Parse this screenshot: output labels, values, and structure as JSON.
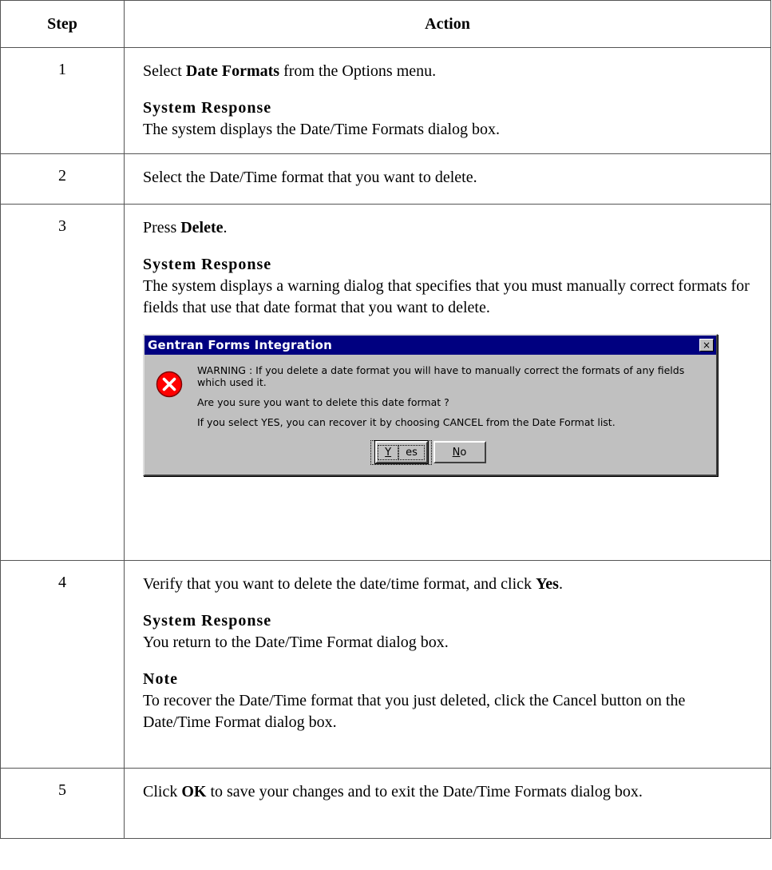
{
  "table": {
    "header_step": "Step",
    "header_action": "Action"
  },
  "steps": [
    {
      "num": "1",
      "text_a": "Select ",
      "bold": "Date Formats",
      "text_b": " from the Options menu.",
      "response_heading": "System Response",
      "response": "The system displays the Date/Time Formats dialog box."
    },
    {
      "num": "2",
      "text": "Select the Date/Time format that you want to delete."
    },
    {
      "num": "3",
      "text_a": "Press ",
      "bold": "Delete",
      "text_b": ".",
      "response_heading": "System Response",
      "response": "The system displays a warning dialog that specifies that you must manually correct formats for fields that use that date format that you want to delete."
    },
    {
      "num": "4",
      "text_a": "Verify that you want to delete the date/time format, and click ",
      "bold": "Yes",
      "text_b": ".",
      "response_heading": "System Response",
      "response": "You return to the Date/Time Format dialog box.",
      "note_heading": "Note",
      "note": "To recover the Date/Time format that you just deleted, click the Cancel button on the Date/Time Format dialog box."
    },
    {
      "num": "5",
      "text_a": "Click ",
      "bold": "OK",
      "text_b": " to save your changes and to exit the Date/Time Formats dialog box."
    }
  ],
  "dialog": {
    "title": "Gentran Forms Integration",
    "close_glyph": "×",
    "icon": "error-icon",
    "line1": "WARNING : If you delete a date format you will have to manually correct the formats of any fields which used it.",
    "line2": "Are you sure you want to delete this date format ?",
    "line3": "If you select YES, you can recover it by choosing CANCEL from the Date Format list.",
    "yes_accel": "Y",
    "yes_rest": "es",
    "no_accel": "N",
    "no_rest": "o"
  }
}
